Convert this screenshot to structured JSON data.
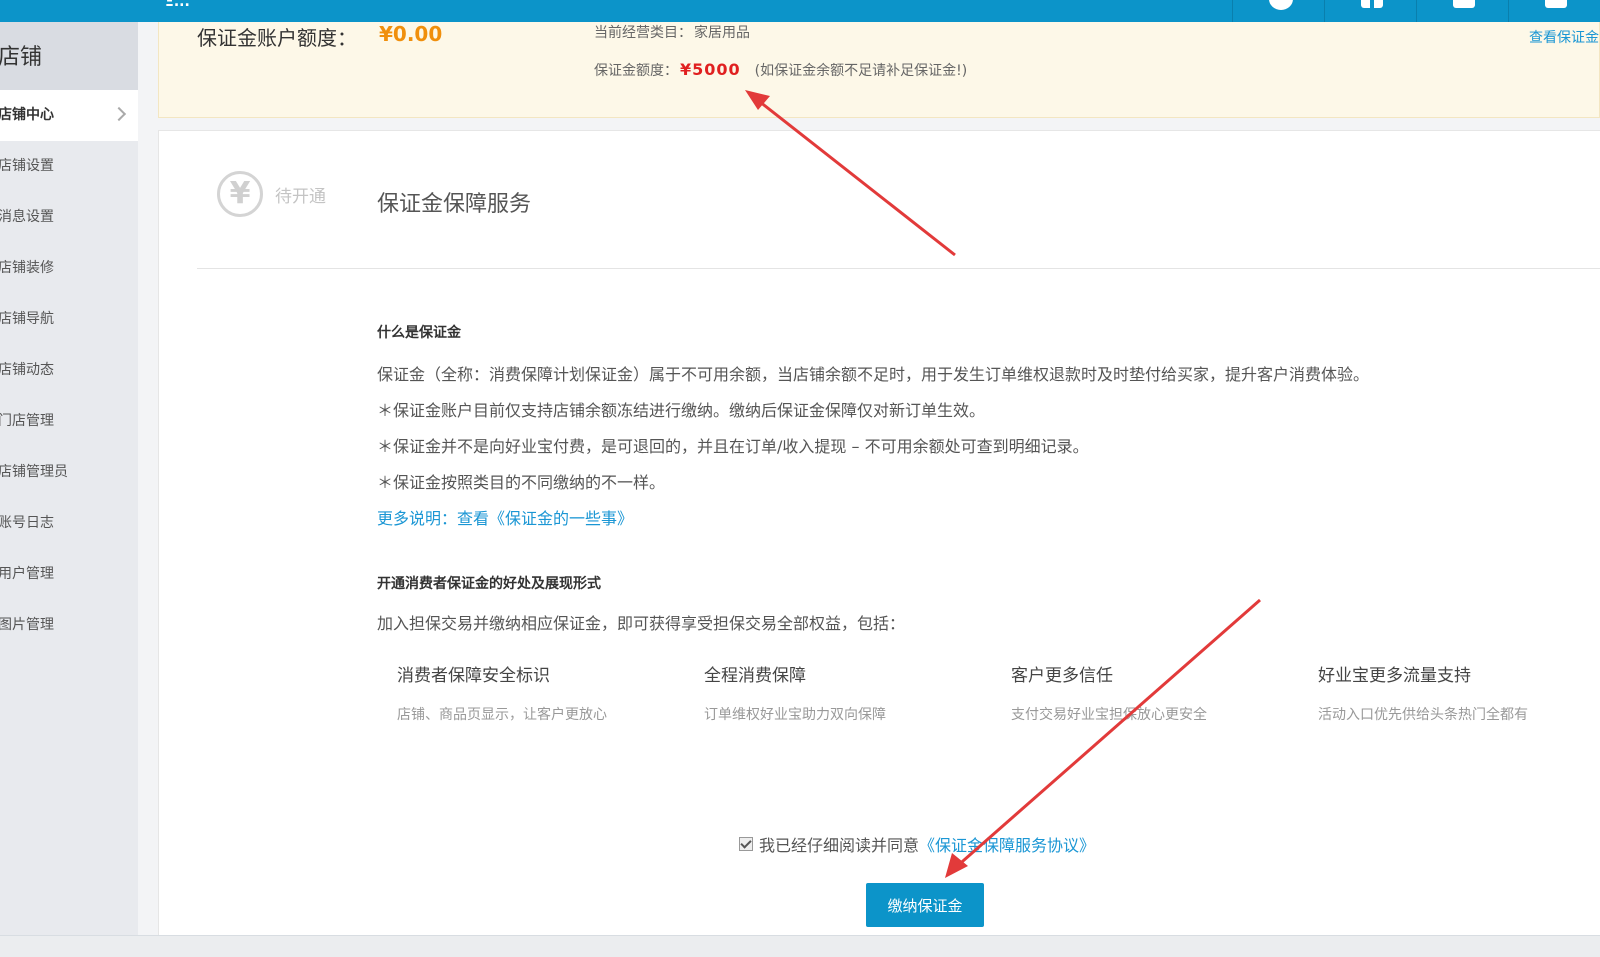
{
  "topbar": {
    "brand_text": "Ξ...",
    "tools": [
      "info-icon",
      "grid-icon",
      "mail-icon",
      "more-icon"
    ]
  },
  "sidebar": {
    "title": "店铺",
    "items": [
      {
        "label": "店铺中心",
        "active": true
      },
      {
        "label": "店铺设置"
      },
      {
        "label": "消息设置"
      },
      {
        "label": "店铺装修"
      },
      {
        "label": "店铺导航"
      },
      {
        "label": "店铺动态"
      },
      {
        "label": "门店管理"
      },
      {
        "label": "店铺管理员"
      },
      {
        "label": "账号日志"
      },
      {
        "label": "用户管理"
      },
      {
        "label": "图片管理"
      }
    ]
  },
  "notice": {
    "balance_label": "保证金账户额度：",
    "balance_value": "¥0.00",
    "category_label": "当前经营类目：",
    "category_value": "家居用品",
    "quota_label": "保证金额度：",
    "quota_value": "¥5000",
    "quota_note": "(如保证金余额不足请补足保证金!)",
    "view_link": "查看保证金"
  },
  "service": {
    "status_icon": "yen-icon",
    "status_text": "待开通",
    "title": "保证金保障服务"
  },
  "what_is": {
    "heading": "什么是保证金",
    "lines": [
      "保证金（全称：消费保障计划保证金）属于不可用余额，当店铺余额不足时，用于发生订单维权退款时及时垫付给买家，提升客户消费体验。",
      "＊保证金账户目前仅支持店铺余额冻结进行缴纳。缴纳后保证金保障仅对新订单生效。",
      "＊保证金并不是向好业宝付费，是可退回的，并且在订单/收入提现 – 不可用余额处可查到明细记录。",
      "＊保证金按照类目的不同缴纳的不一样。"
    ],
    "more_link": "更多说明：查看《保证金的一些事》"
  },
  "benefits": {
    "heading": "开通消费者保证金的好处及展现形式",
    "intro": "加入担保交易并缴纳相应保证金，即可获得享受担保交易全部权益，包括：",
    "items": [
      {
        "title": "消费者保障安全标识",
        "desc": "店铺、商品页显示，让客户更放心"
      },
      {
        "title": "全程消费保障",
        "desc": "订单维权好业宝助力双向保障"
      },
      {
        "title": "客户更多信任",
        "desc": "支付交易好业宝担保放心更安全"
      },
      {
        "title": "好业宝更多流量支持",
        "desc": "活动入口优先供给头条热门全都有"
      }
    ]
  },
  "agreement": {
    "checked": true,
    "text": "我已经仔细阅读并同意",
    "link": "《保证金保障服务协议》"
  },
  "pay_button": "缴纳保证金",
  "colors": {
    "accent": "#0c94c9",
    "warning_amount": "#e02020",
    "balance_amount": "#f08f0c",
    "link": "#1a96d4",
    "arrow": "#e23a3a"
  }
}
